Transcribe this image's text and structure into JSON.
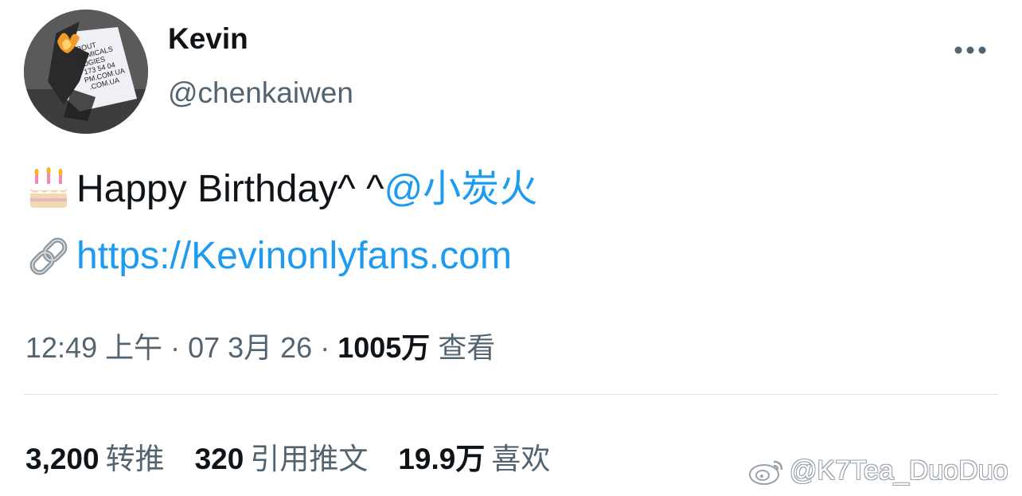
{
  "author": {
    "display_name": "Kevin",
    "handle": "@chenkaiwen",
    "avatar_icon": "burning-paper-avatar"
  },
  "header": {
    "more_icon": "more-horizontal-icon"
  },
  "tweet": {
    "line1_emoji": "birthday-cake-icon",
    "line1_text": "Happy Birthday^ ^",
    "mention": "@小炭火",
    "line2_emoji": "link-icon",
    "url": "https://Kevinonlyfans.com"
  },
  "meta": {
    "time": "12:49 上午",
    "separator1": " · ",
    "date": "07 3月 26",
    "separator2": " · ",
    "views_count": "1005万",
    "views_label": " 查看"
  },
  "stats": {
    "retweets_count": "3,200",
    "retweets_label": "转推",
    "quotes_count": "320",
    "quotes_label": "引用推文",
    "likes_count": "19.9万",
    "likes_label": "喜欢"
  },
  "watermark": {
    "text": "@K7Tea_DuoDuo",
    "icon": "weibo-icon"
  },
  "colors": {
    "link": "#1d9bf0",
    "secondary_text": "#536471",
    "primary_text": "#0f1419"
  }
}
